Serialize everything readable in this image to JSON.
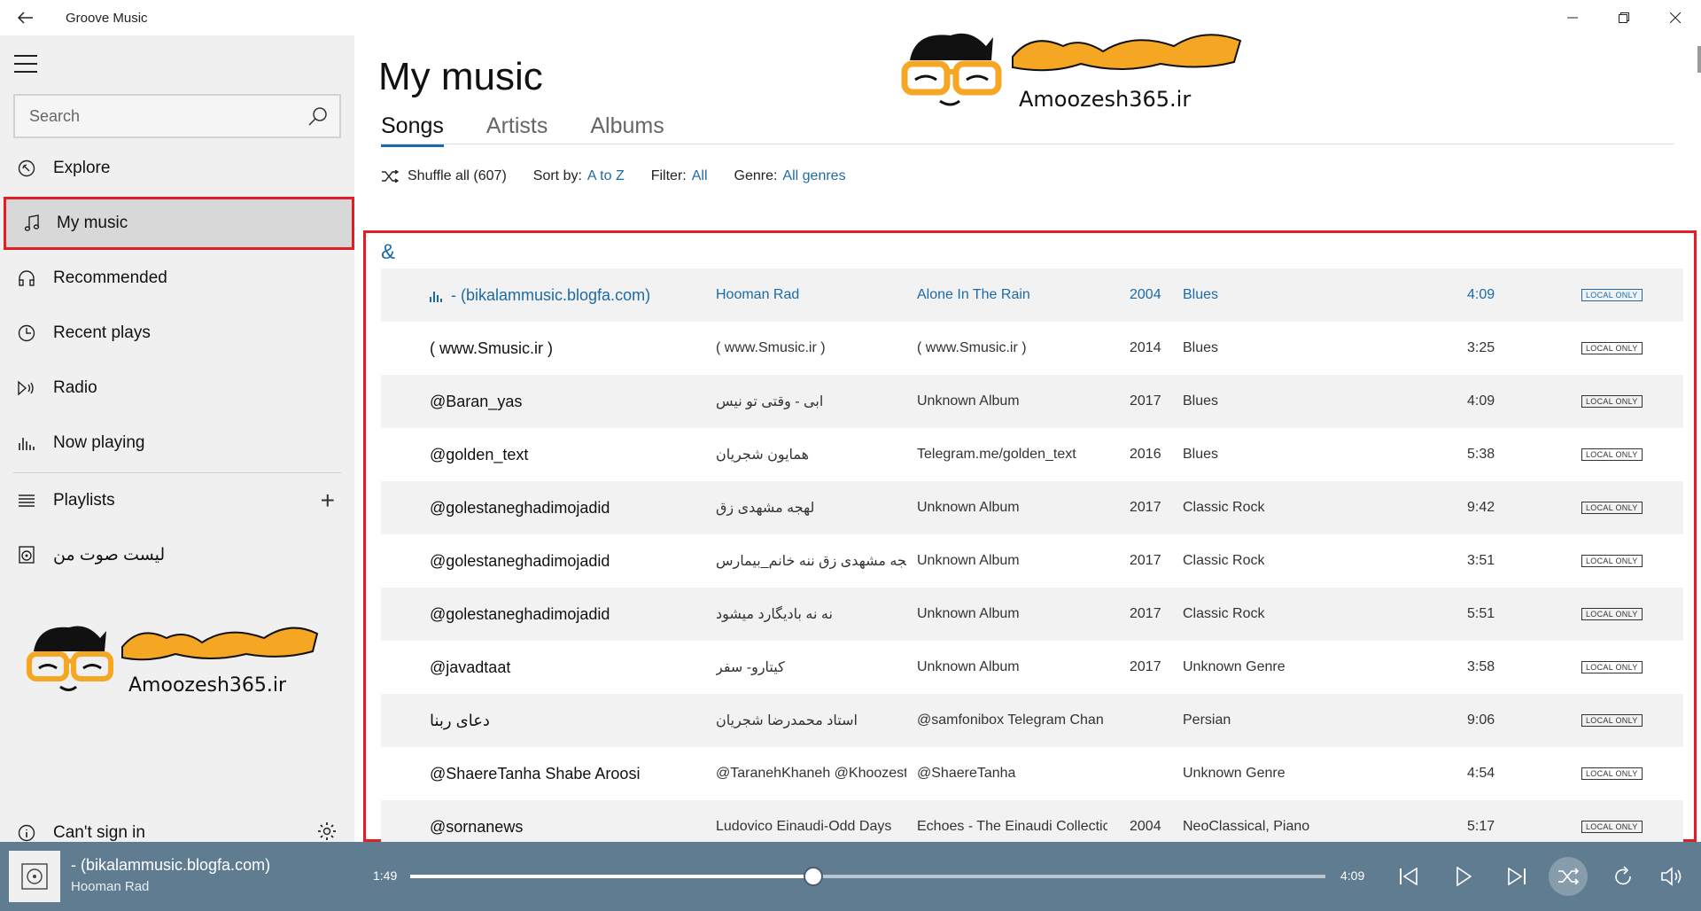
{
  "window": {
    "title": "Groove Music"
  },
  "sidebar": {
    "search_placeholder": "Search",
    "items": [
      {
        "label": "Explore",
        "icon": "compass-icon"
      },
      {
        "label": "My music",
        "icon": "music-note-icon",
        "active": true
      },
      {
        "label": "Recommended",
        "icon": "headphones-icon"
      },
      {
        "label": "Recent plays",
        "icon": "clock-icon"
      },
      {
        "label": "Radio",
        "icon": "radio-icon"
      },
      {
        "label": "Now playing",
        "icon": "equalizer-icon"
      }
    ],
    "playlists_label": "Playlists",
    "user_playlist": "لیست صوت من",
    "signin_label": "Can't sign in"
  },
  "logo": {
    "brand_text": "آمـــوزش ۳۶۵",
    "domain_text": "Amoozesh365.ir"
  },
  "main": {
    "page_title": "My music",
    "tabs": [
      "Songs",
      "Artists",
      "Albums"
    ],
    "active_tab": "Songs",
    "shuffle_label": "Shuffle all (607)",
    "sort_label": "Sort by:",
    "sort_value": "A to Z",
    "filter_label": "Filter:",
    "filter_value": "All",
    "genre_label": "Genre:",
    "genre_value": "All genres",
    "group_letter": "&",
    "badge_text": "LOCAL ONLY",
    "songs": [
      {
        "title": "- (bikalammusic.blogfa.com)",
        "artist": "Hooman Rad",
        "album": "Alone In The Rain",
        "year": "2004",
        "genre": "Blues",
        "duration": "4:09",
        "playing": true
      },
      {
        "title": "( www.Smusic.ir )",
        "artist": "( www.Smusic.ir )",
        "album": "( www.Smusic.ir )",
        "year": "2014",
        "genre": "Blues",
        "duration": "3:25"
      },
      {
        "title": "@Baran_yas",
        "artist": "ابی - وقتی تو نیس",
        "album": "Unknown Album",
        "year": "2017",
        "genre": "Blues",
        "duration": "4:09"
      },
      {
        "title": "@golden_text",
        "artist": "همایون شجریان",
        "album": "Telegram.me/golden_text",
        "year": "2016",
        "genre": "Blues",
        "duration": "5:38"
      },
      {
        "title": "@golestaneghadimojadid",
        "artist": "لهجه مشهدی زق",
        "album": "Unknown Album",
        "year": "2017",
        "genre": "Classic Rock",
        "duration": "9:42"
      },
      {
        "title": "@golestaneghadimojadid",
        "artist": "لهجه مشهدی زق ننه خانم_بیمارس",
        "album": "Unknown Album",
        "year": "2017",
        "genre": "Classic Rock",
        "duration": "3:51"
      },
      {
        "title": "@golestaneghadimojadid",
        "artist": "نه نه بادیگارد میشود",
        "album": "Unknown Album",
        "year": "2017",
        "genre": "Classic Rock",
        "duration": "5:51"
      },
      {
        "title": "@javadtaat",
        "artist": "کیتارو- سفر",
        "album": "Unknown Album",
        "year": "2017",
        "genre": "Unknown Genre",
        "duration": "3:58"
      },
      {
        "title": "دعای ربنا",
        "artist": "استاد محمدرضا شجریان",
        "album": "@samfonibox Telegram Chan",
        "year": "",
        "genre": "Persian",
        "duration": "9:06"
      },
      {
        "title": "@ShaereTanha   Shabe Aroosi",
        "artist": "@TaranehKhaneh @Khoozest",
        "album": "@ShaereTanha",
        "year": "",
        "genre": "Unknown Genre",
        "duration": "4:54"
      },
      {
        "title": "@sornanews",
        "artist": "Ludovico Einaudi-Odd Days",
        "album": "Echoes - The Einaudi Collectic",
        "year": "2004",
        "genre": "NeoClassical, Piano",
        "duration": "5:17"
      }
    ]
  },
  "player": {
    "title": "- (bikalammusic.blogfa.com)",
    "artist": "Hooman Rad",
    "current_time": "1:49",
    "total_time": "4:09",
    "progress": 0.44,
    "shuffle_on": true
  },
  "colors": {
    "accent": "#1b6ba8",
    "highlight_border": "#e21e25",
    "player_bg": "#5f7c91",
    "logo_yellow": "#f5a623"
  }
}
